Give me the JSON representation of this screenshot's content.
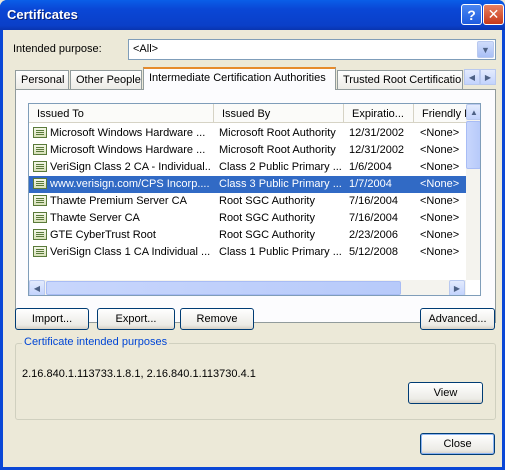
{
  "window": {
    "title": "Certificates"
  },
  "purpose": {
    "label": "Intended purpose:",
    "value": "<All>"
  },
  "tabs": [
    {
      "label": "Personal"
    },
    {
      "label": "Other People"
    },
    {
      "label": "Intermediate Certification Authorities"
    },
    {
      "label": "Trusted Root Certification"
    }
  ],
  "columns": [
    "Issued To",
    "Issued By",
    "Expiratio...",
    "Friendly N"
  ],
  "rows": [
    {
      "issued_to": "Microsoft Windows Hardware ...",
      "issued_by": "Microsoft Root Authority",
      "expiration": "12/31/2002",
      "friendly": "<None>"
    },
    {
      "issued_to": "Microsoft Windows Hardware ...",
      "issued_by": "Microsoft Root Authority",
      "expiration": "12/31/2002",
      "friendly": "<None>"
    },
    {
      "issued_to": "VeriSign Class 2 CA - Individual...",
      "issued_by": "Class 2 Public Primary ...",
      "expiration": "1/6/2004",
      "friendly": "<None>"
    },
    {
      "issued_to": "www.verisign.com/CPS Incorp....",
      "issued_by": "Class 3 Public Primary ...",
      "expiration": "1/7/2004",
      "friendly": "<None>"
    },
    {
      "issued_to": "Thawte Premium Server CA",
      "issued_by": "Root SGC Authority",
      "expiration": "7/16/2004",
      "friendly": "<None>"
    },
    {
      "issued_to": "Thawte Server CA",
      "issued_by": "Root SGC Authority",
      "expiration": "7/16/2004",
      "friendly": "<None>"
    },
    {
      "issued_to": "GTE CyberTrust Root",
      "issued_by": "Root SGC Authority",
      "expiration": "2/23/2006",
      "friendly": "<None>"
    },
    {
      "issued_to": "VeriSign Class 1 CA Individual ...",
      "issued_by": "Class 1 Public Primary ...",
      "expiration": "5/12/2008",
      "friendly": "<None>"
    }
  ],
  "buttons": {
    "import": "Import...",
    "export": "Export...",
    "remove": "Remove",
    "advanced": "Advanced...",
    "view": "View",
    "close": "Close"
  },
  "purposes_group": {
    "title": "Certificate intended purposes",
    "text": "2.16.840.1.113733.1.8.1, 2.16.840.1.113730.4.1"
  }
}
